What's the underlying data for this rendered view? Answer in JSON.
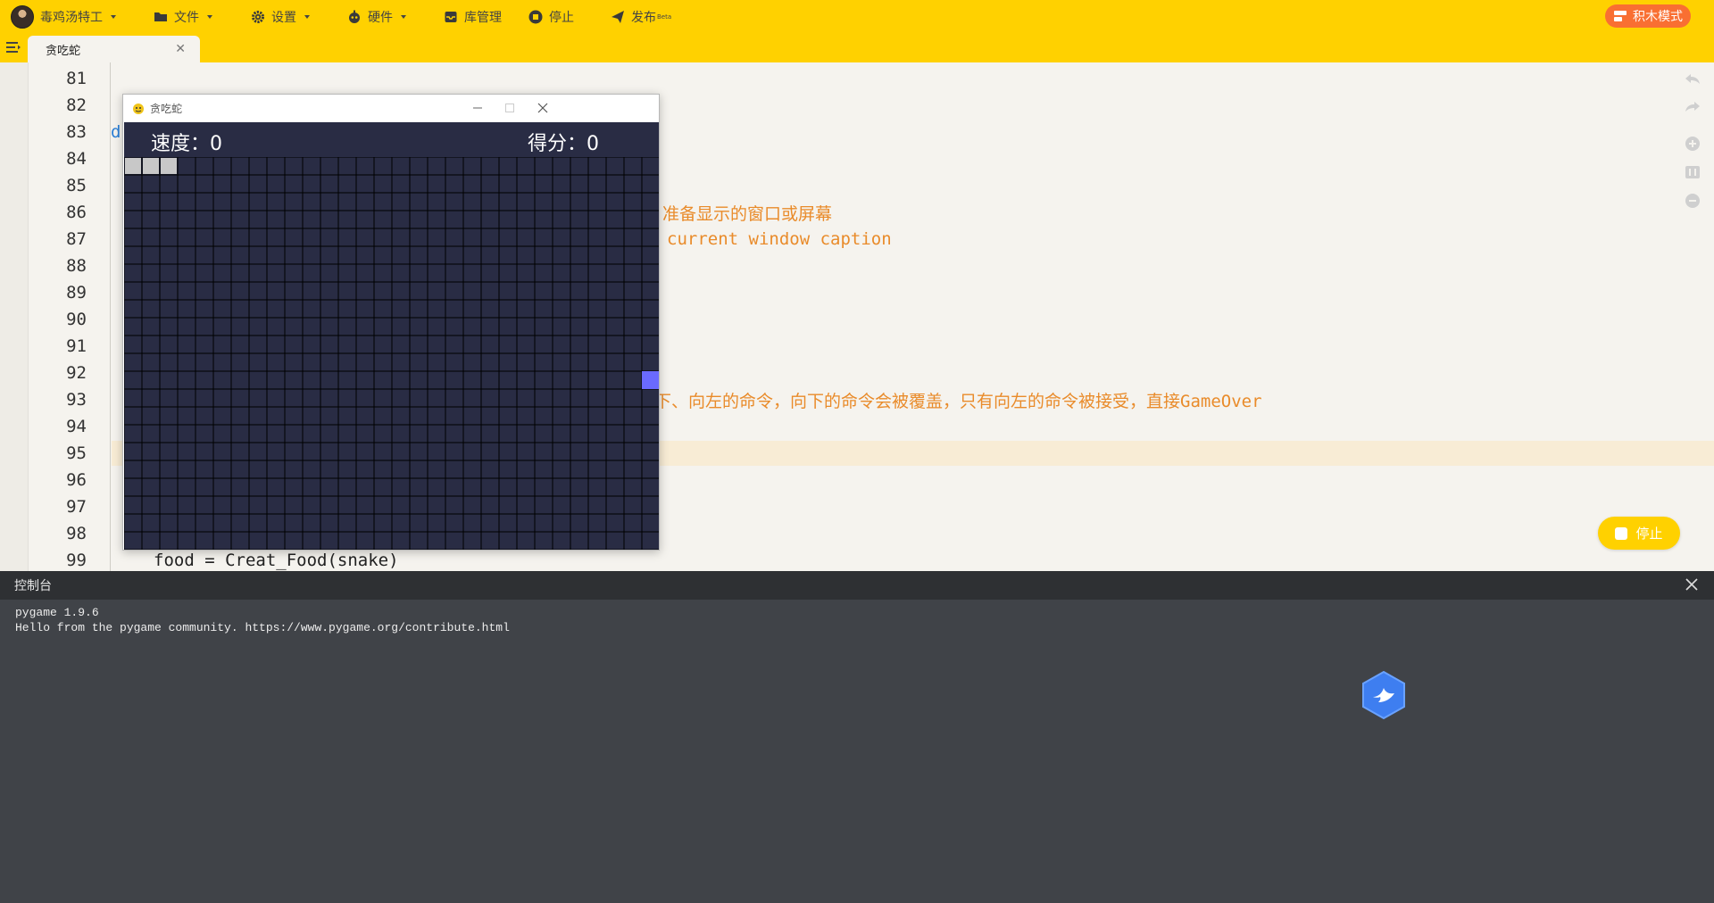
{
  "menu": {
    "user": "毒鸡汤特工",
    "file": "文件",
    "settings": "设置",
    "hardware": "硬件",
    "library": "库管理",
    "stop": "停止",
    "publish": "发布",
    "publish_badge": "Beta",
    "mode_button": "积木模式"
  },
  "tab": {
    "title": "贪吃蛇"
  },
  "editor": {
    "line_numbers": [
      "81",
      "82",
      "83",
      "84",
      "85",
      "86",
      "87",
      "88",
      "89",
      "90",
      "91",
      "92",
      "93",
      "94",
      "95",
      "96",
      "97",
      "98",
      "99"
    ],
    "current_line": "95",
    "code": {
      "line83_fragment": "d",
      "line86_comment": "准备显示的窗口或屏幕",
      "line87_comment": "current window caption",
      "line93_comment": "下、向左的命令，向下的命令会被覆盖，只有向左的命令被接受，直接GameOver",
      "line99": "food = Creat_Food(snake)"
    },
    "stop_button": "停止"
  },
  "console": {
    "title": "控制台",
    "lines": [
      "pygame 1.9.6",
      "Hello from the pygame community. https://www.pygame.org/contribute.html"
    ]
  },
  "game_window": {
    "title": "贪吃蛇",
    "speed_label": "速度：",
    "speed_value": "0",
    "score_label": "得分：",
    "score_value": "0",
    "grid_cols": 30,
    "grid_rows": 22,
    "snake_cells": [
      [
        0,
        0
      ],
      [
        1,
        0
      ],
      [
        2,
        0
      ]
    ],
    "food_cell": [
      29,
      12
    ],
    "colors": {
      "background": "#292c44",
      "grid_line": "#000000",
      "snake": "#c8c8c8",
      "food": "#6a6aff"
    }
  },
  "colors": {
    "topbar": "#ffd100",
    "mode_button": "#f96f32",
    "comment": "#e98b2a",
    "console_bg": "#404348"
  }
}
